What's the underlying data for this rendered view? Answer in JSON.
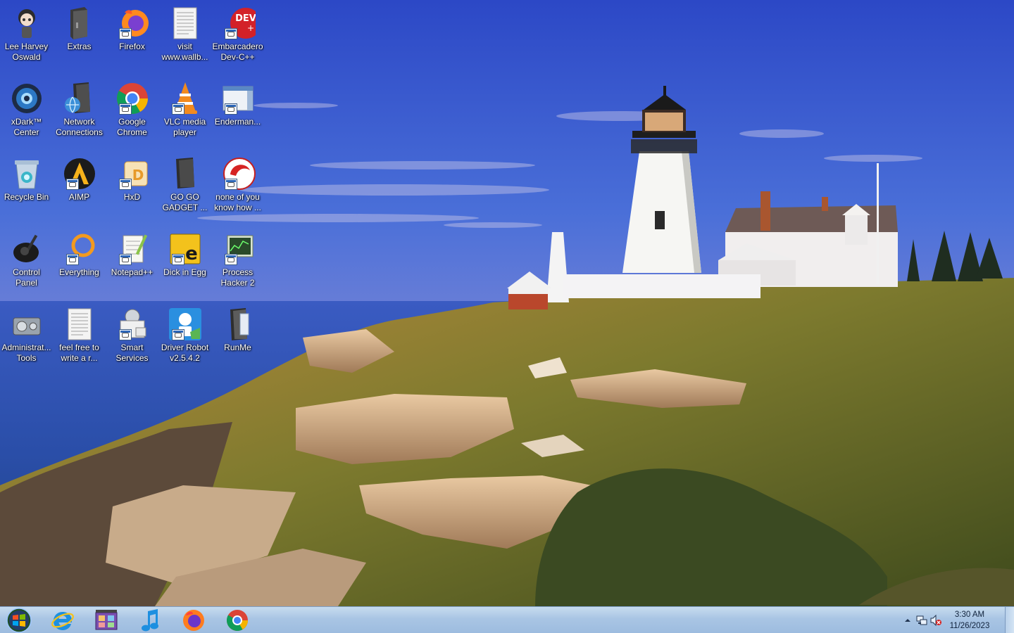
{
  "desktop": {
    "wallpaper": "lighthouse-wallpaper",
    "icons": [
      {
        "label": "Lee Harvey\nOswald",
        "icon": "cartoon-character-icon"
      },
      {
        "label": "Extras",
        "icon": "folder-icon"
      },
      {
        "label": "Firefox",
        "icon": "firefox-icon"
      },
      {
        "label": "visit\nwww.wallb...",
        "icon": "text-document-icon"
      },
      {
        "label": "Embarcadero\nDev-C++",
        "icon": "devcpp-icon"
      },
      {
        "label": "xDark™\nCenter",
        "icon": "xdark-center-icon"
      },
      {
        "label": "Network\nConnections",
        "icon": "network-connections-icon"
      },
      {
        "label": "Google\nChrome",
        "icon": "chrome-icon"
      },
      {
        "label": "VLC media\nplayer",
        "icon": "vlc-icon"
      },
      {
        "label": "Enderman...",
        "icon": "window-icon"
      },
      {
        "label": "Recycle Bin",
        "icon": "recycle-bin-icon"
      },
      {
        "label": "AIMP",
        "icon": "aimp-icon"
      },
      {
        "label": "HxD",
        "icon": "hxd-icon"
      },
      {
        "label": "GO GO\nGADGET ...",
        "icon": "gadget-icon"
      },
      {
        "label": "none of you\nknow how ...",
        "icon": "red-circle-icon"
      },
      {
        "label": "Control\nPanel",
        "icon": "control-panel-icon"
      },
      {
        "label": "Everything",
        "icon": "everything-search-icon"
      },
      {
        "label": "Notepad++",
        "icon": "notepadpp-icon"
      },
      {
        "label": "Dick in Egg",
        "icon": "egg-icon"
      },
      {
        "label": "Process\nHacker 2",
        "icon": "process-hacker-icon"
      },
      {
        "label": "Administrat...\nTools",
        "icon": "admin-tools-icon"
      },
      {
        "label": "feel free to\nwrite a r...",
        "icon": "text-document-icon"
      },
      {
        "label": "Smart\nServices",
        "icon": "smart-services-icon"
      },
      {
        "label": "Driver Robot\nv2.5.4.2",
        "icon": "driver-robot-icon"
      },
      {
        "label": "RunMe",
        "icon": "runme-file-icon"
      }
    ]
  },
  "taskbar": {
    "start_icon": "windows-start-orb-icon",
    "pinned": [
      {
        "name": "internet-explorer",
        "icon": "internet-explorer-icon"
      },
      {
        "name": "film-app",
        "icon": "film-strip-icon"
      },
      {
        "name": "music-app",
        "icon": "music-note-icon"
      },
      {
        "name": "firefox",
        "icon": "firefox-icon"
      },
      {
        "name": "chrome",
        "icon": "chrome-icon"
      }
    ],
    "tray": {
      "icons": [
        "show-hidden-icons-arrow-icon",
        "network-icon",
        "volume-muted-icon"
      ],
      "time": "3:30 AM",
      "date": "11/26/2023"
    }
  },
  "colors": {
    "taskbar": "#a9c5e4",
    "label_text": "#ffffff",
    "sky": "#3e63d4",
    "sea": "#2d55b8"
  }
}
